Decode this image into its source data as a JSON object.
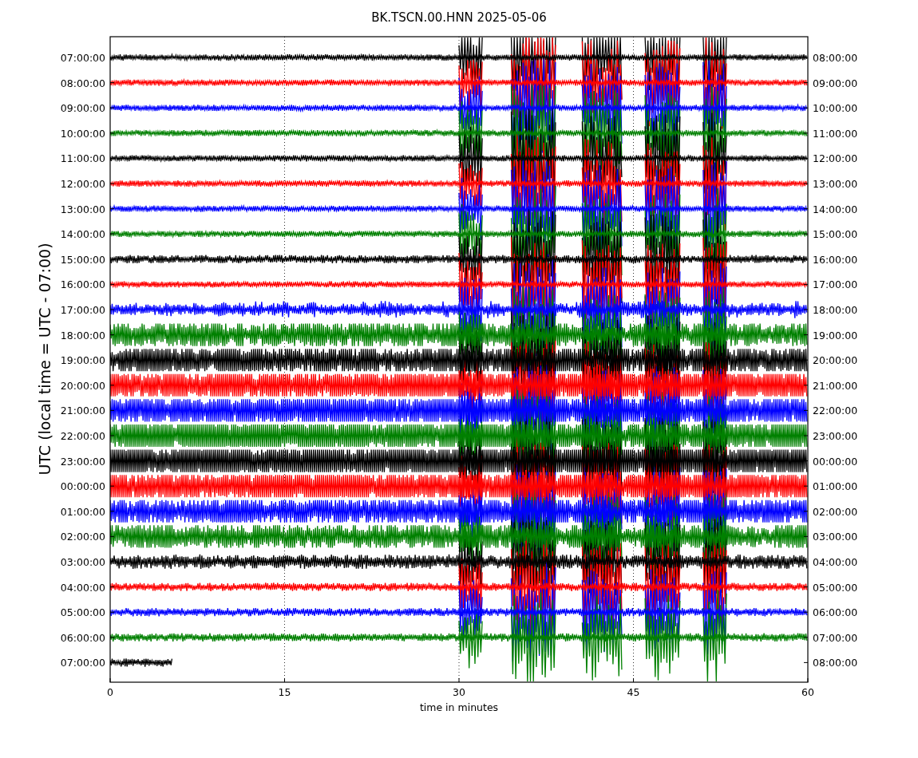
{
  "title": "BK.TSCN.00.HNN 2025-05-06",
  "ylabel": "UTC (local time = UTC - 07:00)",
  "xlabel": "time in minutes",
  "xticks": [
    "0",
    "15",
    "30",
    "45",
    "60"
  ],
  "rows": [
    {
      "left": "07:00:00",
      "right": "08:00:00",
      "color": "#000000",
      "level": 1
    },
    {
      "left": "08:00:00",
      "right": "09:00:00",
      "color": "#ff0000",
      "level": 1
    },
    {
      "left": "09:00:00",
      "right": "10:00:00",
      "color": "#0000ff",
      "level": 1
    },
    {
      "left": "10:00:00",
      "right": "11:00:00",
      "color": "#008000",
      "level": 1
    },
    {
      "left": "11:00:00",
      "right": "12:00:00",
      "color": "#000000",
      "level": 1
    },
    {
      "left": "12:00:00",
      "right": "13:00:00",
      "color": "#ff0000",
      "level": 1
    },
    {
      "left": "13:00:00",
      "right": "14:00:00",
      "color": "#0000ff",
      "level": 1
    },
    {
      "left": "14:00:00",
      "right": "15:00:00",
      "color": "#008000",
      "level": 1
    },
    {
      "left": "15:00:00",
      "right": "16:00:00",
      "color": "#000000",
      "level": 1
    },
    {
      "left": "16:00:00",
      "right": "17:00:00",
      "color": "#ff0000",
      "level": 1
    },
    {
      "left": "17:00:00",
      "right": "18:00:00",
      "color": "#0000ff",
      "level": 1
    },
    {
      "left": "18:00:00",
      "right": "19:00:00",
      "color": "#008000",
      "level": 1
    },
    {
      "left": "19:00:00",
      "right": "20:00:00",
      "color": "#000000",
      "level": 1
    },
    {
      "left": "20:00:00",
      "right": "21:00:00",
      "color": "#ff0000",
      "level": 1
    },
    {
      "left": "21:00:00",
      "right": "22:00:00",
      "color": "#0000ff",
      "level": 1
    },
    {
      "left": "22:00:00",
      "right": "23:00:00",
      "color": "#008000",
      "level": 1
    },
    {
      "left": "23:00:00",
      "right": "00:00:00",
      "color": "#000000",
      "level": 1
    },
    {
      "left": "00:00:00",
      "right": "01:00:00",
      "color": "#ff0000",
      "level": 1
    },
    {
      "left": "01:00:00",
      "right": "02:00:00",
      "color": "#0000ff",
      "level": 1
    },
    {
      "left": "02:00:00",
      "right": "03:00:00",
      "color": "#008000",
      "level": 1
    },
    {
      "left": "03:00:00",
      "right": "04:00:00",
      "color": "#000000",
      "level": 1
    },
    {
      "left": "04:00:00",
      "right": "05:00:00",
      "color": "#ff0000",
      "level": 1
    },
    {
      "left": "05:00:00",
      "right": "06:00:00",
      "color": "#0000ff",
      "level": 1
    },
    {
      "left": "06:00:00",
      "right": "07:00:00",
      "color": "#008000",
      "level": 1
    },
    {
      "left": "07:00:00",
      "right": "08:00:00",
      "color": "#000000",
      "level": 0.09
    }
  ]
}
